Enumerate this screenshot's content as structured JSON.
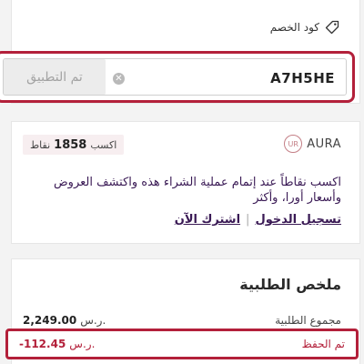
{
  "discount": {
    "label": "كود الخصم",
    "code_value": "A7H5HE",
    "apply_label": "تم التطبيق"
  },
  "aura": {
    "brand": "AURA",
    "points_prefix": "اكسب",
    "points_value": "1858",
    "points_suffix": "نقاط",
    "description": "اكسب نقاطاً عند إتمام عملية الشراء هذه واكتشف العروض وأسعار أورا، وأكثر",
    "login_label": "تسجيل الدخول",
    "signup_label": "اشترك الآن"
  },
  "summary": {
    "title": "ملخص الطلبية",
    "subtotal_label": "مجموع الطلبية",
    "subtotal_value": "2,249.00",
    "currency": "ر.س.",
    "saving_label": "تم الحفظ",
    "saving_value": "-112.45"
  },
  "colors": {
    "accent": "#b3203a",
    "link": "#3a1a55"
  }
}
